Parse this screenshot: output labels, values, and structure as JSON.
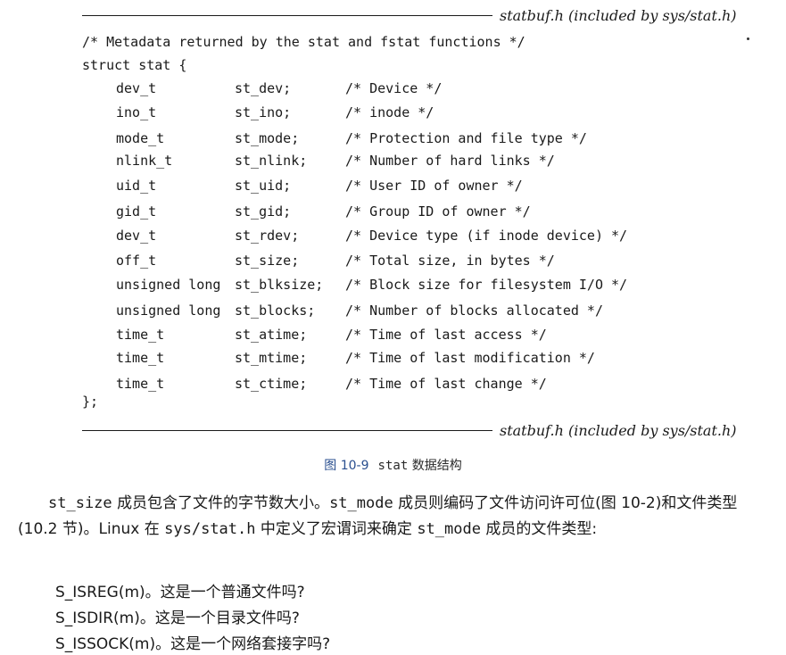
{
  "header_file": "statbuf.h (included by sys/stat.h)",
  "footer_file": "statbuf.h (included by sys/stat.h)",
  "code": {
    "comment_line": "/* Metadata returned by the stat and fstat functions */",
    "struct_open": "struct stat {",
    "struct_close": "};",
    "fields": [
      {
        "type": "dev_t",
        "name": "st_dev;",
        "comment": "/* Device */"
      },
      {
        "type": "ino_t",
        "name": "st_ino;",
        "comment": "/* inode */"
      },
      {
        "type": "mode_t",
        "name": "st_mode;",
        "comment": "/* Protection and file type */"
      },
      {
        "type": "nlink_t",
        "name": "st_nlink;",
        "comment": "/* Number of hard links */"
      },
      {
        "type": "uid_t",
        "name": "st_uid;",
        "comment": "/* User ID of owner */"
      },
      {
        "type": "gid_t",
        "name": "st_gid;",
        "comment": "/* Group ID of owner */"
      },
      {
        "type": "dev_t",
        "name": "st_rdev;",
        "comment": "/* Device type (if inode device) */"
      },
      {
        "type": "off_t",
        "name": "st_size;",
        "comment": "/* Total size, in bytes */"
      },
      {
        "type": "unsigned long",
        "name": "st_blksize;",
        "comment": "/* Block size for filesystem I/O */"
      },
      {
        "type": "unsigned long",
        "name": "st_blocks;",
        "comment": "/* Number of blocks allocated */"
      },
      {
        "type": "time_t",
        "name": "st_atime;",
        "comment": "/* Time of last access */"
      },
      {
        "type": "time_t",
        "name": "st_mtime;",
        "comment": "/* Time of last modification */"
      },
      {
        "type": "time_t",
        "name": "st_ctime;",
        "comment": "/* Time of last change */"
      }
    ]
  },
  "caption": {
    "figure": "图 10-9",
    "mono": "stat",
    "text": "数据结构"
  },
  "paragraph": {
    "s1_mono": "st_size",
    "s1_text": "成员包含了文件的字节数大小。",
    "s2_mono": "st_mode",
    "s2_text": "成员则编码了文件访问许可位(图 10-2)和文件类型(10.2 节)。Linux 在",
    "s3_mono": "sys/stat.h",
    "s3_text": "中定义了宏谓词来确定",
    "s4_mono": "st_mode",
    "s4_text": "成员的文件类型:"
  },
  "items": [
    "S_ISREG(m)。这是一个普通文件吗?",
    "S_ISDIR(m)。这是一个目录文件吗?",
    "S_ISSOCK(m)。这是一个网络套接字吗?"
  ]
}
